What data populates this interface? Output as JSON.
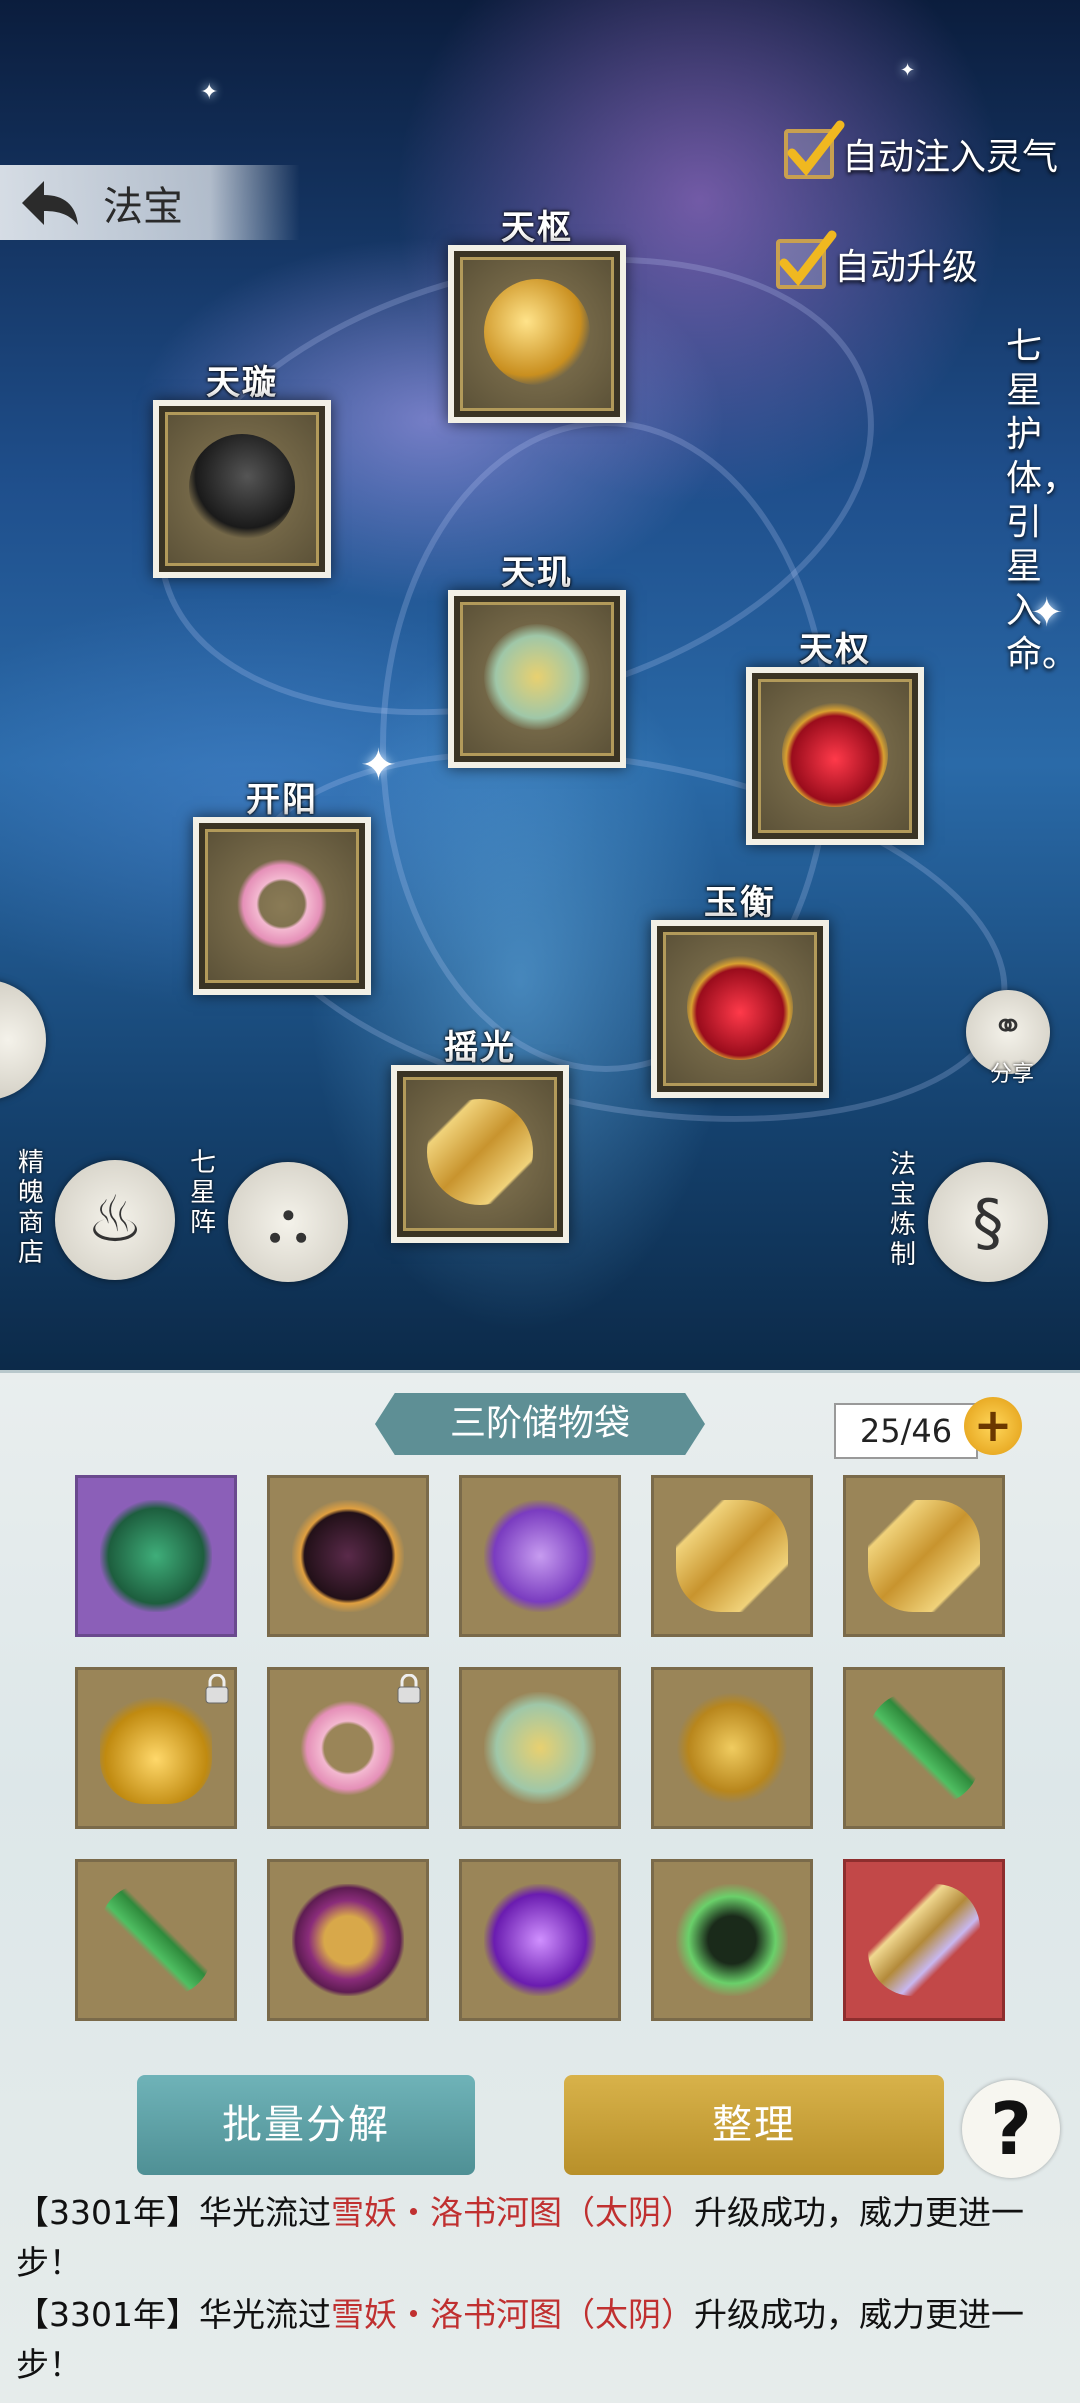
{
  "header": {
    "back_label": "法宝"
  },
  "options": [
    {
      "label": "自动注入灵气",
      "checked": true
    },
    {
      "label": "自动升级",
      "checked": true
    }
  ],
  "motto": "七星护体，引星入命。",
  "artifacts": [
    {
      "label": "天枢",
      "icon": "golden-feather-icon"
    },
    {
      "label": "天璇",
      "icon": "feather-fan-icon"
    },
    {
      "label": "天玑",
      "icon": "jade-pestle-icon"
    },
    {
      "label": "天权",
      "icon": "red-gem-pendant-icon"
    },
    {
      "label": "开阳",
      "icon": "pink-jade-ring-icon"
    },
    {
      "label": "玉衡",
      "icon": "red-gem-pendant-icon"
    },
    {
      "label": "摇光",
      "icon": "golden-scroll-icon"
    }
  ],
  "side_buttons": {
    "shop": "精魄商店",
    "formation": "七星阵",
    "share": "分享",
    "refine": "法宝炼制"
  },
  "bag": {
    "title": "三阶储物袋",
    "count": "25/46",
    "add": "+"
  },
  "items": [
    {
      "icon": "jade-qilin-icon",
      "rarity": "purple"
    },
    {
      "icon": "dark-umbrella-icon",
      "rarity": "normal"
    },
    {
      "icon": "purple-gourd-icon",
      "rarity": "normal"
    },
    {
      "icon": "golden-scroll-icon",
      "rarity": "normal"
    },
    {
      "icon": "golden-scroll-icon",
      "rarity": "normal"
    },
    {
      "icon": "golden-bell-icon",
      "rarity": "normal",
      "locked": true
    },
    {
      "icon": "pink-jade-ring-icon",
      "rarity": "normal",
      "locked": true
    },
    {
      "icon": "jade-pestle-icon",
      "rarity": "normal"
    },
    {
      "icon": "golden-ruyi-icon",
      "rarity": "normal"
    },
    {
      "icon": "green-flute-icon",
      "rarity": "normal"
    },
    {
      "icon": "green-flute-icon",
      "rarity": "normal"
    },
    {
      "icon": "bronze-mirror-icon",
      "rarity": "normal"
    },
    {
      "icon": "purple-orb-icon",
      "rarity": "normal"
    },
    {
      "icon": "green-crane-orb-icon",
      "rarity": "normal"
    },
    {
      "icon": "ribbon-scroll-icon",
      "rarity": "red"
    }
  ],
  "buttons": {
    "decompose": "批量分解",
    "sort": "整理",
    "help": "?"
  },
  "messages": [
    {
      "prefix": "【3301年】华光流过",
      "highlight": "雪妖・洛书河图（太阴）",
      "suffix": "升级成功，威力更进一步！"
    },
    {
      "prefix": "【3301年】华光流过",
      "highlight": "雪妖・洛书河图（太阴）",
      "suffix": "升级成功，威力更进一步！"
    }
  ],
  "colors": {
    "accent_teal": "#5e8f95",
    "accent_gold": "#d8b24a",
    "highlight_red": "#c03030"
  }
}
